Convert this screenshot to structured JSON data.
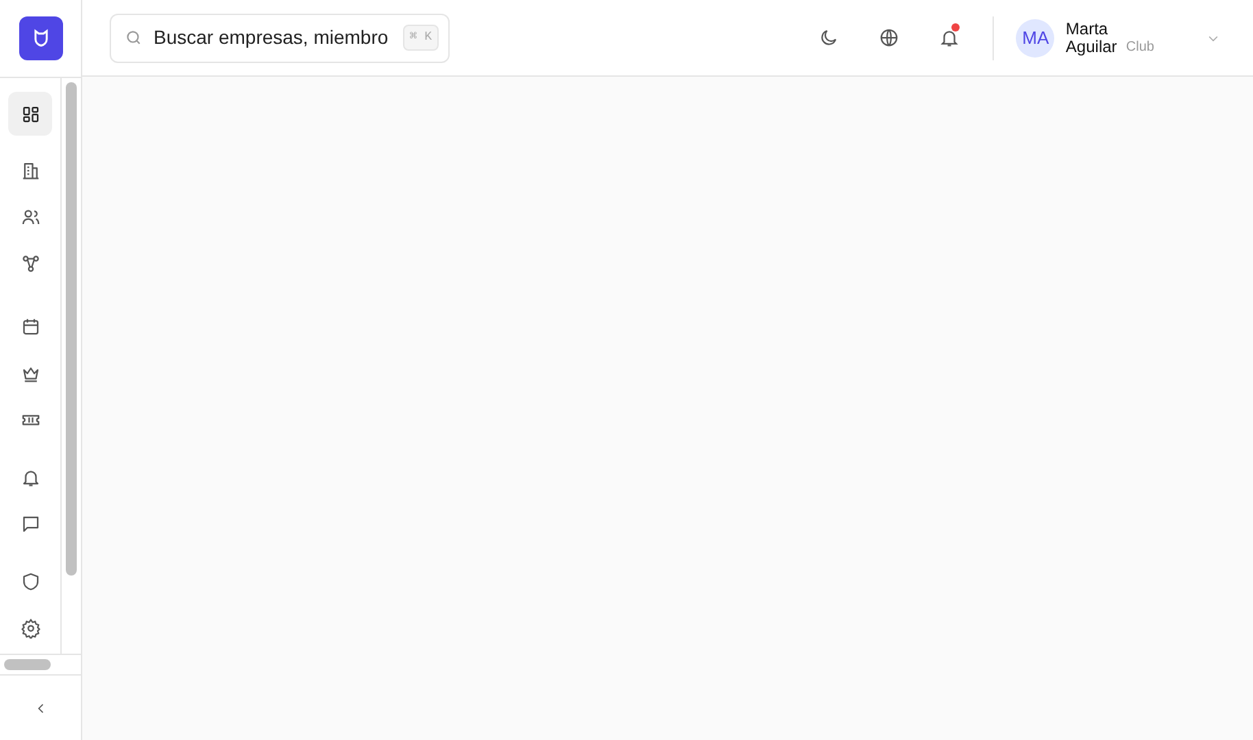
{
  "search": {
    "placeholder": "Buscar empresas, miembro",
    "shortcut": [
      "⌘",
      "K"
    ]
  },
  "header": {
    "notification_unread": true,
    "user": {
      "initials": "MA",
      "name": "Marta Aguilar",
      "subtitle": "Club"
    }
  },
  "sidebar": {
    "items": [
      {
        "kind": "dashboard",
        "selected": true
      },
      {
        "kind": "building",
        "selected": false
      },
      {
        "kind": "users",
        "selected": false
      },
      {
        "kind": "network",
        "selected": false
      },
      {
        "kind": "calendar",
        "selected": false
      },
      {
        "kind": "crown",
        "selected": false
      },
      {
        "kind": "ticket",
        "selected": false
      },
      {
        "kind": "bell",
        "selected": false
      },
      {
        "kind": "chat",
        "selected": false
      },
      {
        "kind": "shield",
        "selected": false
      },
      {
        "kind": "settings",
        "selected": false
      }
    ]
  }
}
